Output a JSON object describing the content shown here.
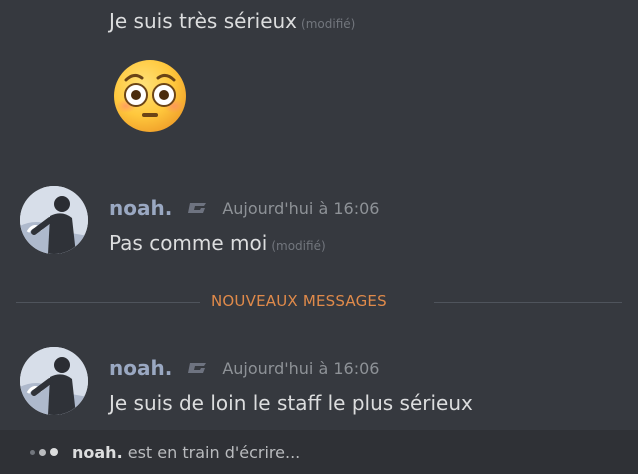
{
  "messages": [
    {
      "text": "Je suis très sérieux",
      "edited": "(modifié)"
    },
    {
      "author": "noah.",
      "timestamp": "Aujourd'hui à 16:06",
      "text": "Pas comme moi",
      "edited": "(modifié)"
    },
    {
      "author": "noah.",
      "timestamp": "Aujourd'hui à 16:06",
      "text": "Je suis de loin le staff le plus sérieux"
    }
  ],
  "emoji": "flushed-face",
  "new_messages_divider": "NOUVEAUX MESSAGES",
  "typing": {
    "user": "noah.",
    "suffix": "est en train d'écrire..."
  },
  "colors": {
    "background": "#36393f",
    "typing_bar": "#2f3136",
    "username": "#9aa8c2",
    "new_messages": "#e08a4a"
  }
}
